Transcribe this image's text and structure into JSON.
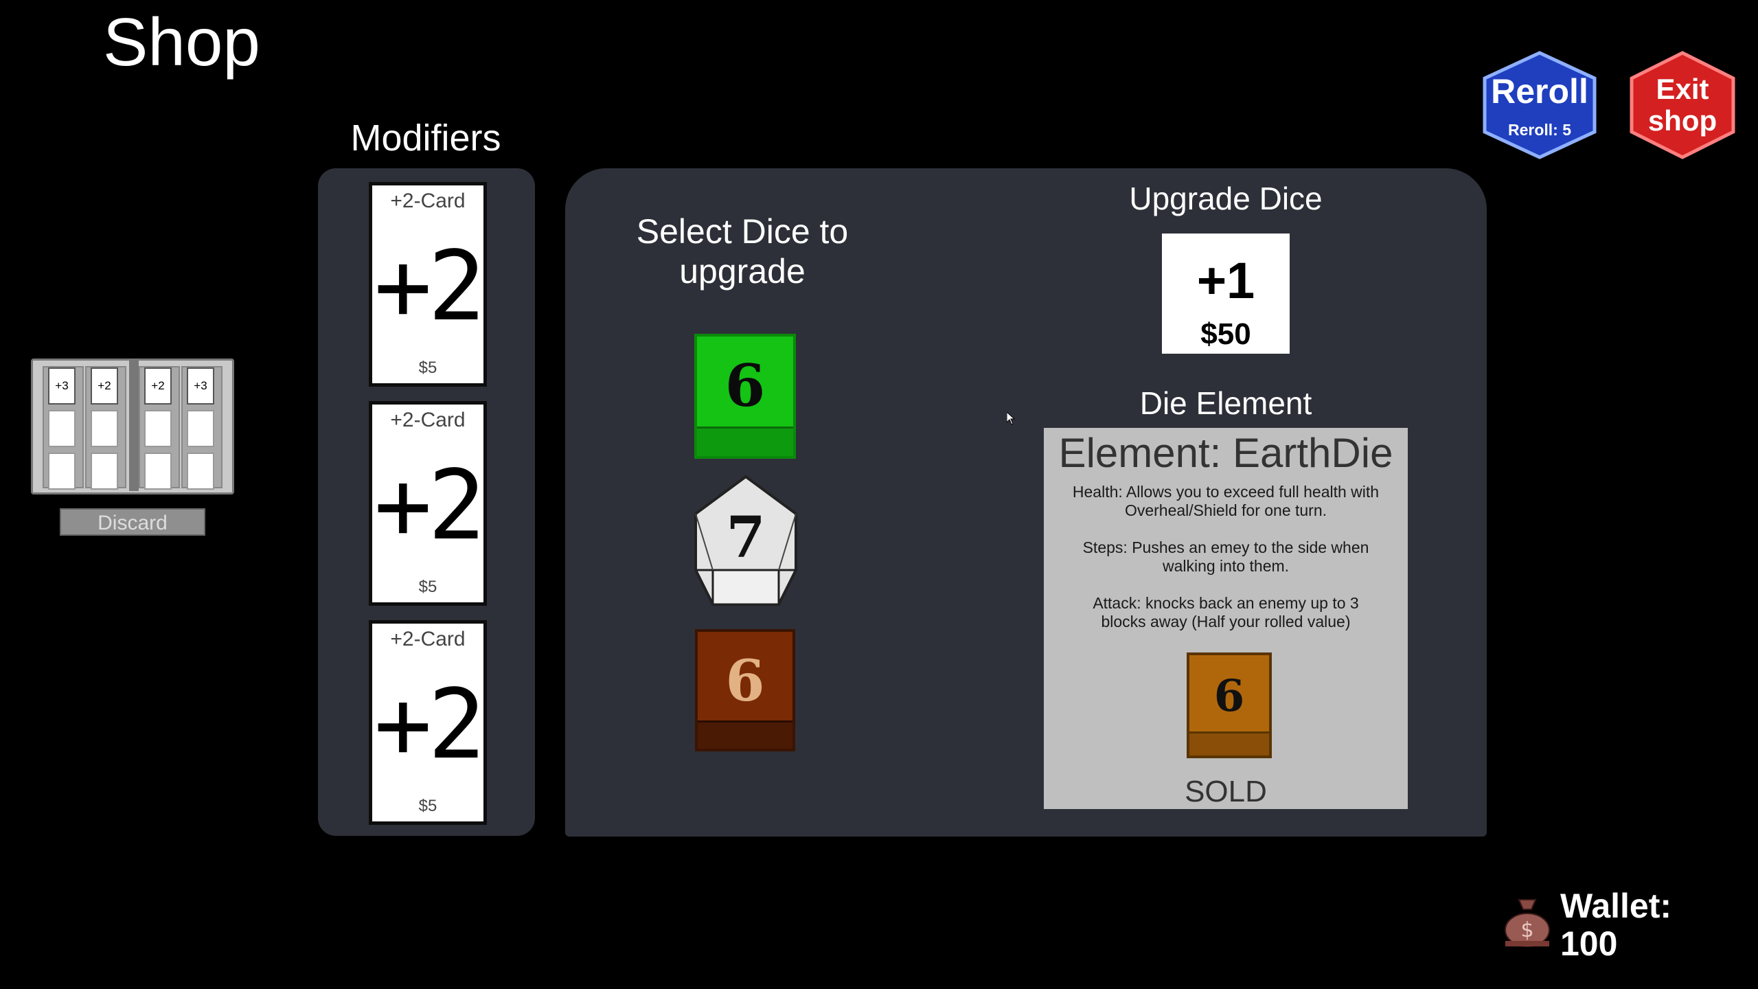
{
  "header": {
    "title": "Shop"
  },
  "modifiers": {
    "title": "Modifiers",
    "cards": [
      {
        "name": "+2-Card",
        "value": "+2",
        "price": "$5"
      },
      {
        "name": "+2-Card",
        "value": "+2",
        "price": "$5"
      },
      {
        "name": "+2-Card",
        "value": "+2",
        "price": "$5"
      }
    ]
  },
  "deck": {
    "mini_cards": [
      "+3",
      "+2",
      "+2",
      "+3"
    ],
    "discard_label": "Discard"
  },
  "select_dice": {
    "title": "Select Dice to upgrade",
    "dice": [
      {
        "value": "6",
        "type": "d6",
        "color": "#14c314",
        "selected": true
      },
      {
        "value": "7",
        "type": "d10",
        "color": "#e4e4e4",
        "selected": false
      },
      {
        "value": "6",
        "type": "d6",
        "color": "#7a2a05",
        "selected": false
      }
    ]
  },
  "upgrade": {
    "title": "Upgrade Dice",
    "value": "+1",
    "price": "$50"
  },
  "die_element": {
    "title": "Die Element",
    "name": "Element: EarthDie",
    "health_line1": "Health: Allows you to exceed full health with",
    "health_line2": "Overheal/Shield for one turn.",
    "steps_line1": "Steps: Pushes an emey to the side when",
    "steps_line2": "walking into them.",
    "attack_line1": "Attack: knocks back an enemy up to 3",
    "attack_line2": "blocks away (Half your rolled value)",
    "die_value": "6",
    "die_color": "#b0670c",
    "status": "SOLD"
  },
  "buttons": {
    "reroll_label": "Reroll",
    "reroll_count": "Reroll: 5",
    "exit_line1": "Exit",
    "exit_line2": "shop"
  },
  "wallet": {
    "label": "Wallet:",
    "amount": "100"
  }
}
